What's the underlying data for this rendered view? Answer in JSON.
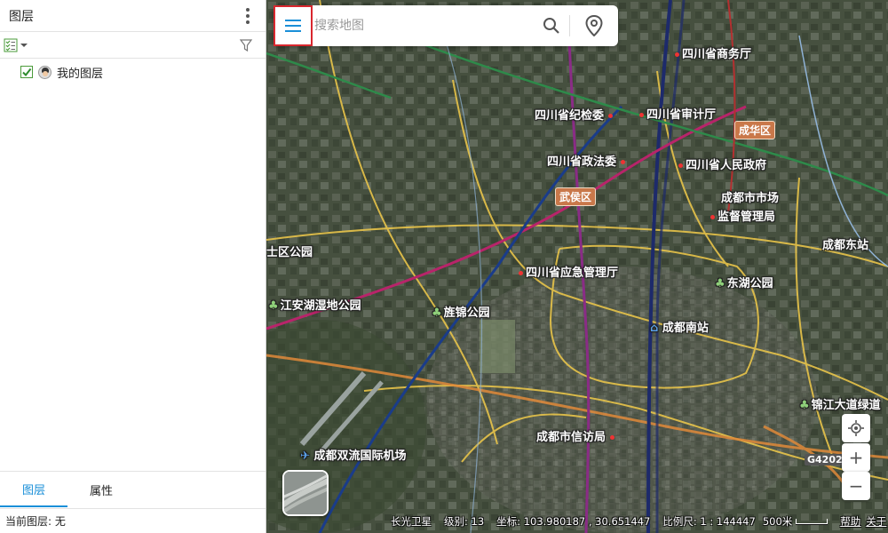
{
  "panel": {
    "title": "图层",
    "layer_name": "我的图层",
    "tabs": [
      {
        "label": "图层"
      },
      {
        "label": "属性"
      }
    ],
    "status": "当前图层: 无"
  },
  "search": {
    "placeholder": "搜索地图"
  },
  "map": {
    "districts": {
      "chenghua": "成华区",
      "wuhou": "武侯区"
    },
    "pois": {
      "commerce": "四川省商务厅",
      "discipline": "四川省纪检委",
      "audit": "四川省审计厅",
      "politics_law": "四川省政法委",
      "gov": "四川省人民政府",
      "market_line1": "成都市市场",
      "market_line2": "监督管理局",
      "emergency": "四川省应急管理厅",
      "petition": "成都市信访局",
      "east_station": "成都东站",
      "south_station": "成都南站",
      "airport": "成都双流国际机场",
      "dongfu_park": "东湖公园",
      "jingjie_park": "旌锦公园",
      "wetland_park": "江安湖湿地公园",
      "district_park": "士区公园",
      "jinjiang_greenway": "锦江大道绿道",
      "expressway": "G4202"
    }
  },
  "footer": {
    "source": "长光卫星",
    "level": "级别: 13",
    "coords": "坐标: 103.980187 , 30.651447",
    "scale_text": "比例尺: 1 : 144447",
    "scale_label": "500米",
    "help": "帮助",
    "about": "关于"
  },
  "icons": {
    "menu": "menu-icon",
    "search": "search-icon",
    "location_pin": "location-pin-icon",
    "locate": "locate-icon",
    "zoom_in": "plus-icon",
    "zoom_out": "minus-icon",
    "filter": "filter-icon",
    "more": "kebab-icon"
  },
  "colors": {
    "accent": "#1a8fd8",
    "menu_highlight": "#d9272e",
    "district_badge": "#c9784a",
    "checkbox": "#4a9b3a"
  }
}
